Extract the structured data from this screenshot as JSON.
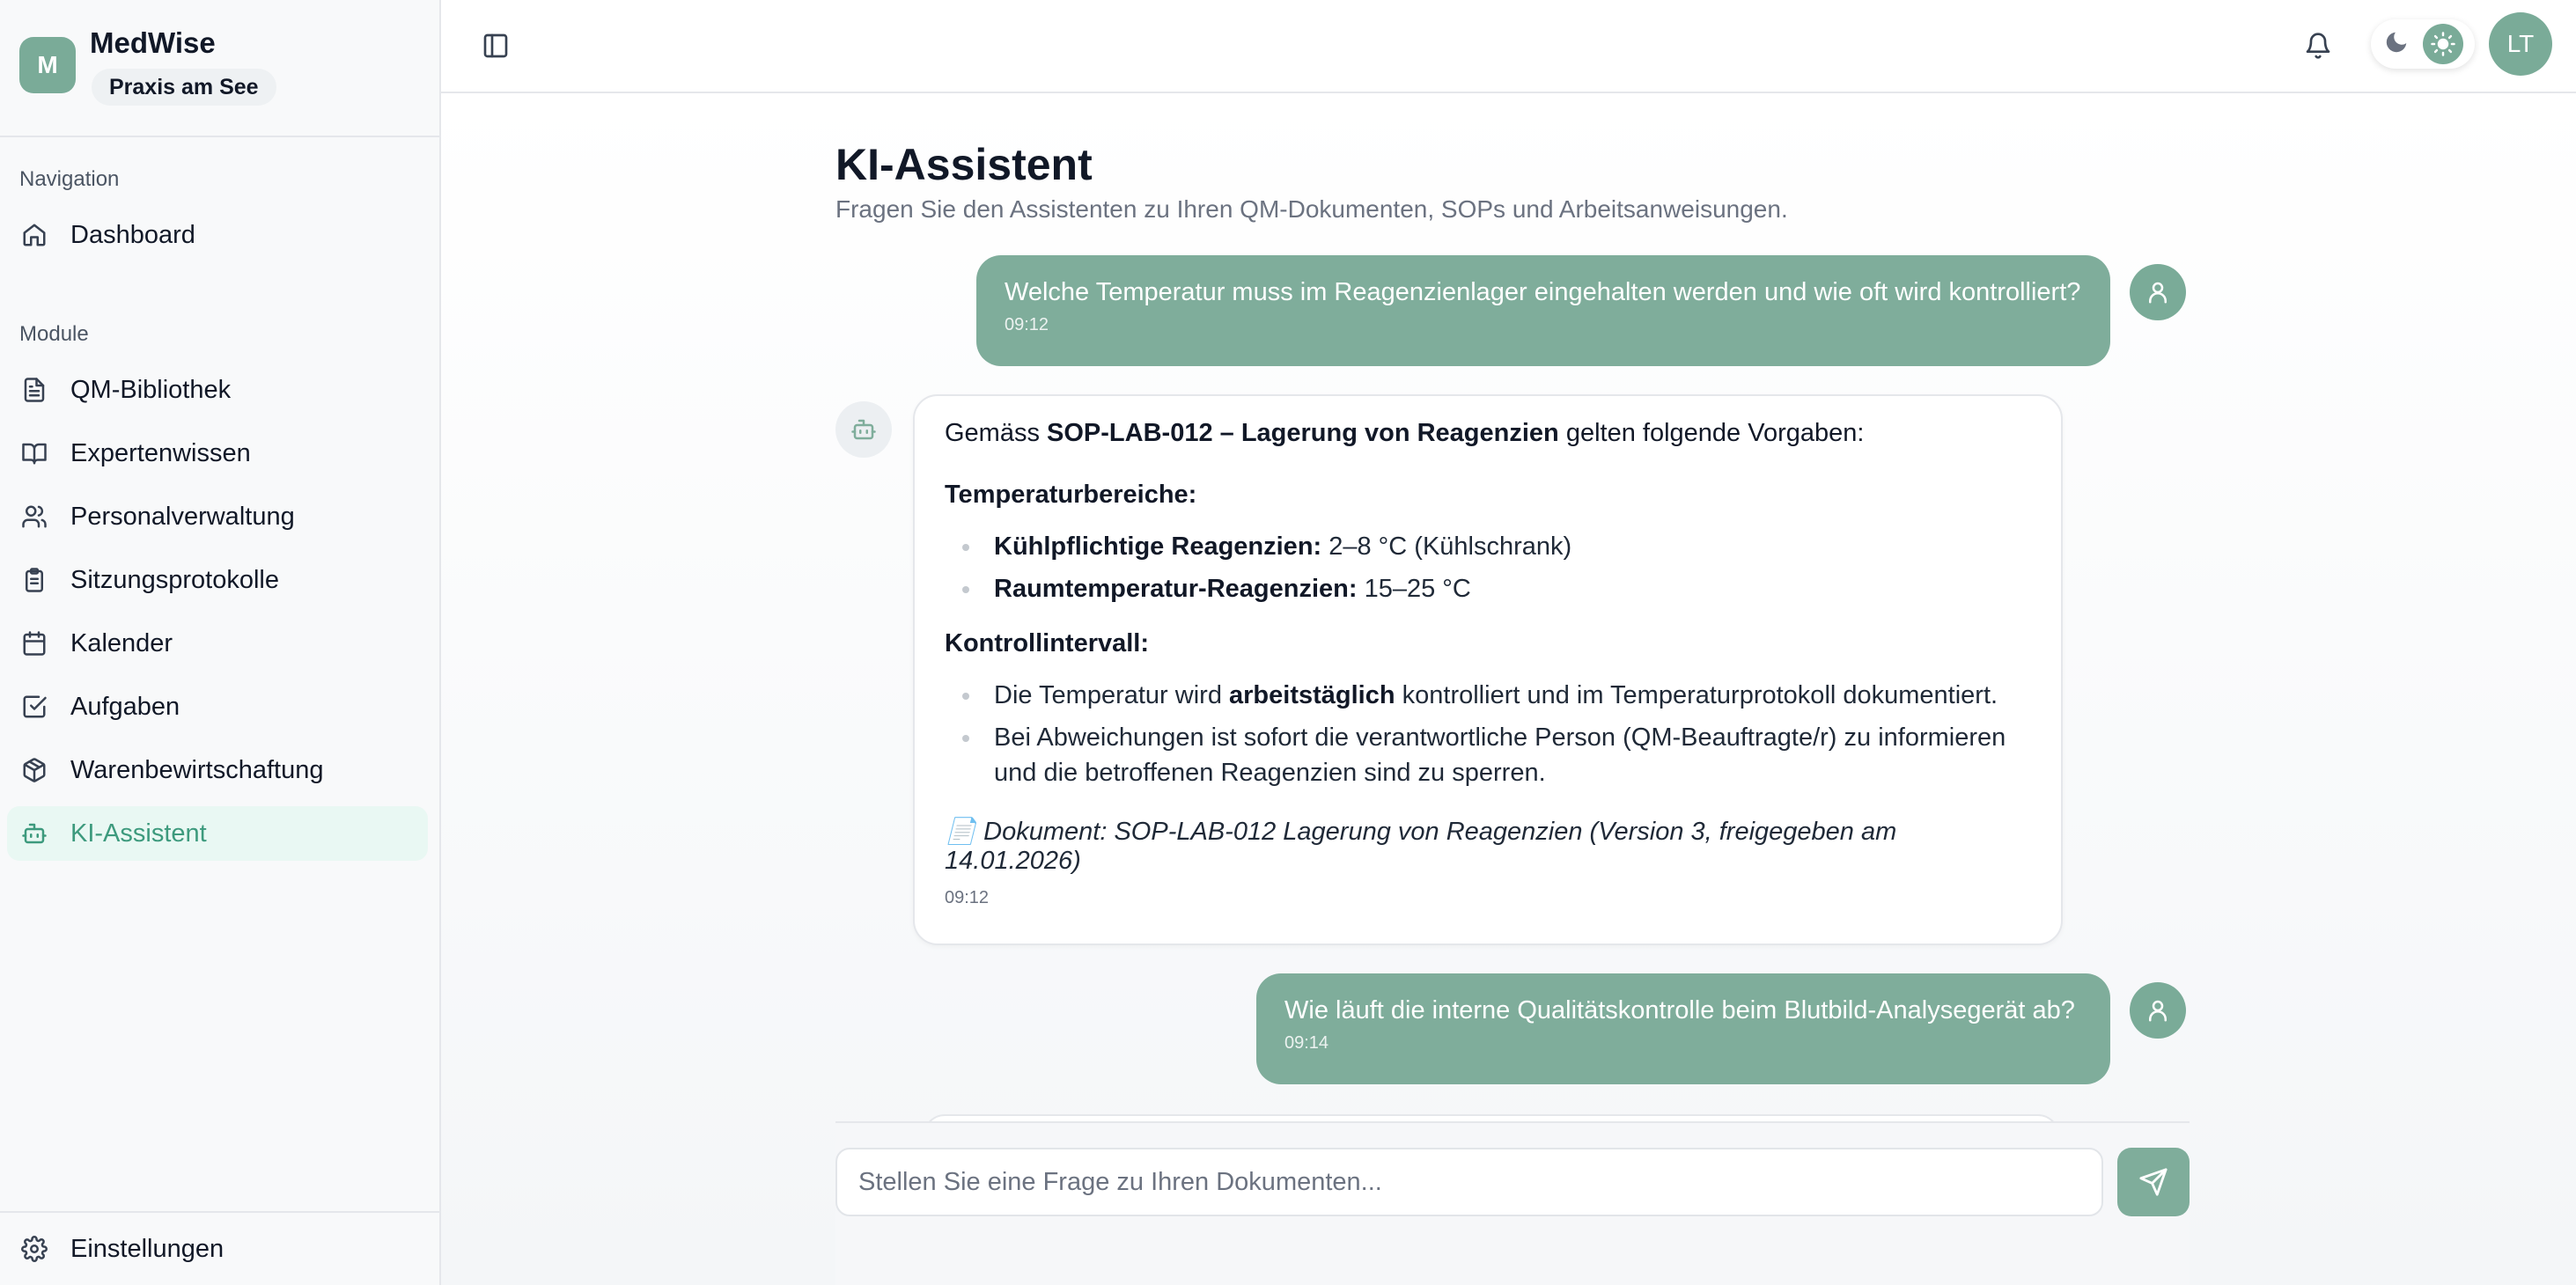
{
  "brand": {
    "avatar_letter": "M",
    "name": "MedWise",
    "practice": "Praxis am See"
  },
  "sidebar": {
    "section_navigation": "Navigation",
    "dashboard": "Dashboard",
    "section_modules": "Module",
    "items": [
      {
        "label": "QM-Bibliothek",
        "icon": "document-icon"
      },
      {
        "label": "Expertenwissen",
        "icon": "book-icon"
      },
      {
        "label": "Personalverwaltung",
        "icon": "users-icon"
      },
      {
        "label": "Sitzungsprotokolle",
        "icon": "clipboard-icon"
      },
      {
        "label": "Kalender",
        "icon": "calendar-icon"
      },
      {
        "label": "Aufgaben",
        "icon": "checkbox-icon"
      },
      {
        "label": "Warenbewirtschaftung",
        "icon": "package-icon"
      },
      {
        "label": "KI-Assistent",
        "icon": "bot-icon",
        "active": true
      }
    ],
    "settings": "Einstellungen"
  },
  "header": {
    "user_initials": "LT"
  },
  "page": {
    "title": "KI-Assistent",
    "subtitle": "Fragen Sie den Assistenten zu Ihren QM-Dokumenten, SOPs und Arbeitsanweisungen."
  },
  "messages": {
    "user1": {
      "text": "Welche Temperatur muss im Reagenzienlager eingehalten werden und wie oft wird kontrolliert?",
      "time": "09:12"
    },
    "bot1": {
      "intro_pre": "Gemäss ",
      "intro_bold": "SOP-LAB-012 – Lagerung von Reagenzien",
      "intro_post": " gelten folgende Vorgaben:",
      "heading1": "Temperaturbereiche:",
      "temp_items": [
        {
          "bold": "Kühlpflichtige Reagenzien:",
          "text": " 2–8 °C (Kühlschrank)"
        },
        {
          "bold": "Raumtemperatur-Reagenzien:",
          "text": " 15–25 °C"
        }
      ],
      "heading2": "Kontrollintervall:",
      "ctrl1_pre": "Die Temperatur wird ",
      "ctrl1_bold": "arbeitstäglich",
      "ctrl1_post": " kontrolliert und im Temperaturprotokoll dokumentiert.",
      "ctrl2": "Bei Abweichungen ist sofort die verantwortliche Person (QM-Beauftragte/r) zu informieren und die betroffenen Reagenzien sind zu sperren.",
      "doc_icon": "📄",
      "doc": "Dokument: SOP-LAB-012 Lagerung von Reagenzien (Version 3, freigegeben am 14.01.2026)",
      "time": "09:12"
    },
    "user2": {
      "text": "Wie läuft die interne Qualitätskontrolle beim Blutbild-Analysegerät ab?",
      "time": "09:14"
    }
  },
  "input": {
    "placeholder": "Stellen Sie eine Frage zu Ihren Dokumenten..."
  },
  "colors": {
    "accent": "#7fad9b",
    "active_bg": "#e9f8f3",
    "active_text": "#3d9a7d"
  }
}
